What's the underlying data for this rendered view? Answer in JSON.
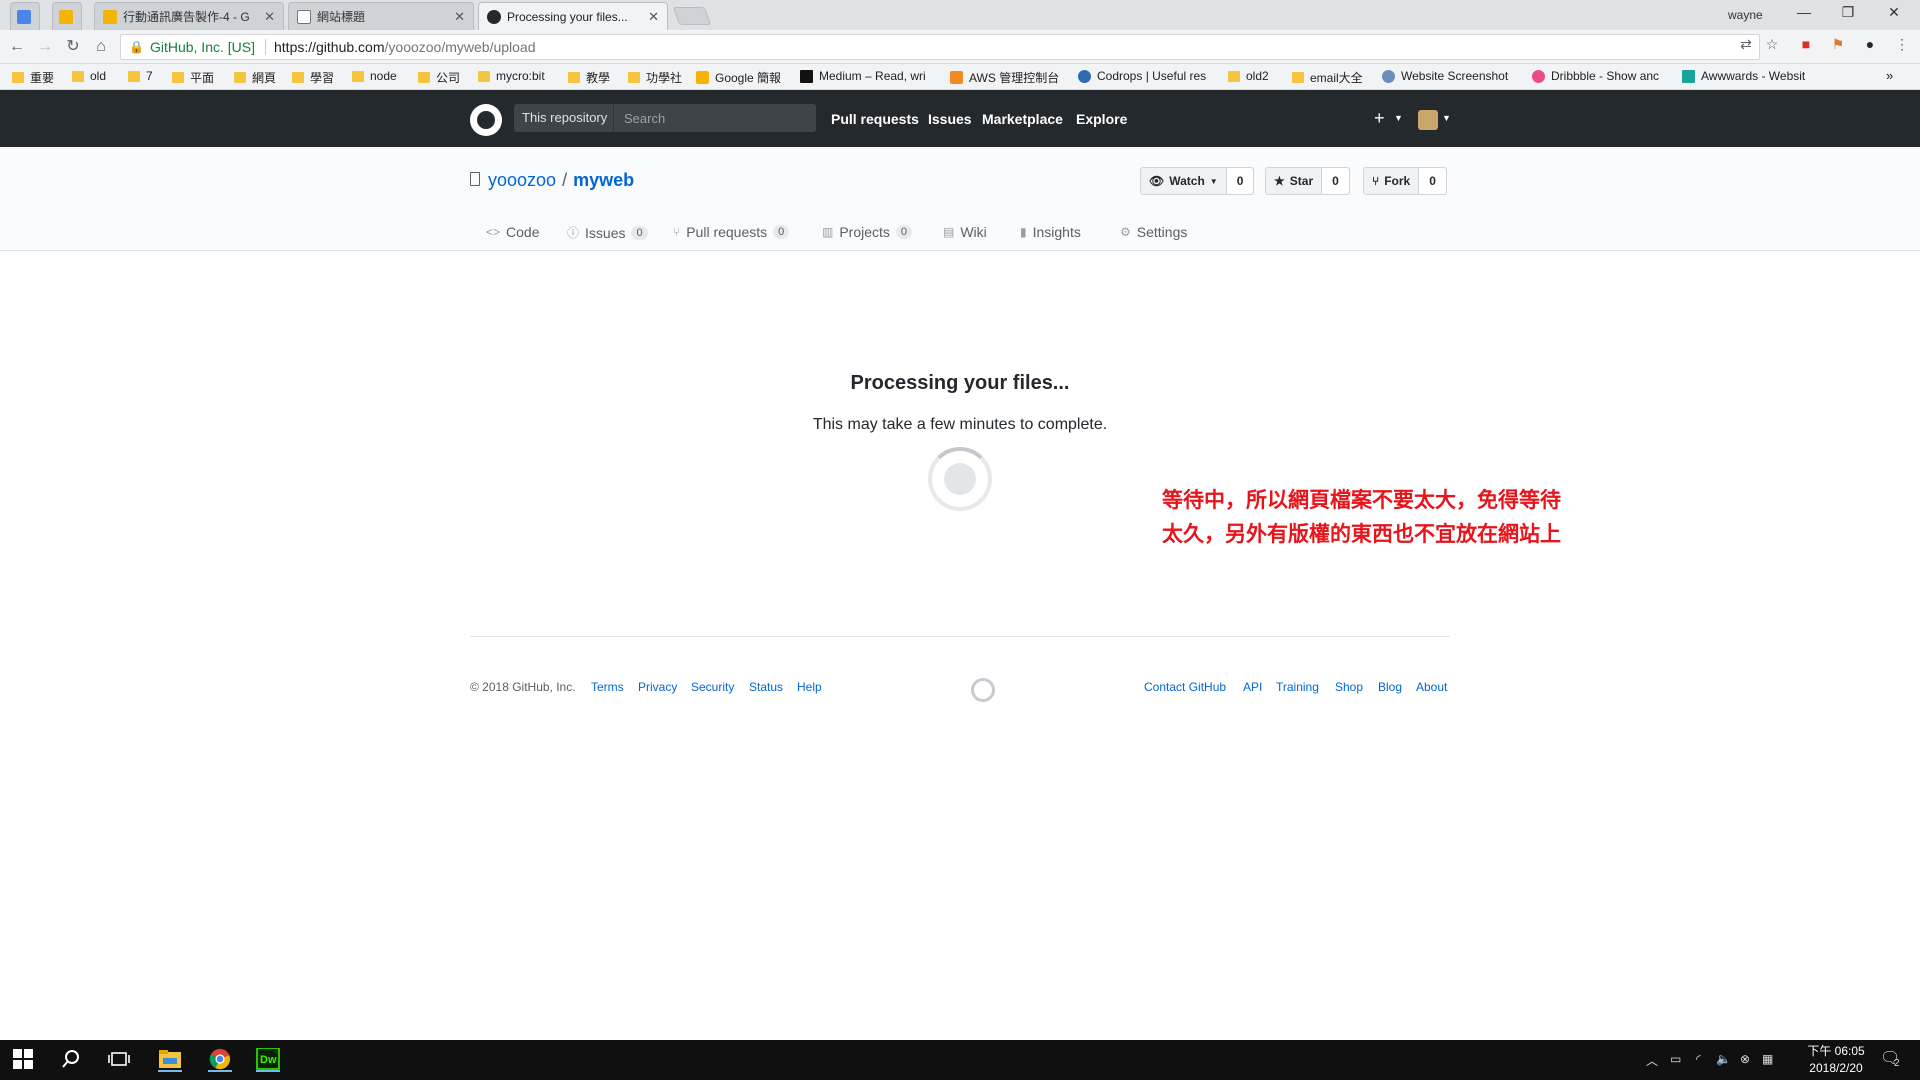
{
  "browser": {
    "tabs": [
      {
        "title": "",
        "active": false
      },
      {
        "title": "",
        "active": false
      },
      {
        "title": "行動通訊廣告製作-4 - G",
        "active": false
      },
      {
        "title": "網站標題",
        "active": false
      },
      {
        "title": "Processing your files...",
        "active": true
      }
    ],
    "profile_name": "wayne",
    "security_label": "GitHub, Inc. [US]",
    "url_host": "https://github.com",
    "url_path": "/yooozoo/myweb/upload",
    "bookmarks": [
      {
        "label": "重要",
        "type": "folder"
      },
      {
        "label": "old",
        "type": "folder"
      },
      {
        "label": "7",
        "type": "folder"
      },
      {
        "label": "平面",
        "type": "folder"
      },
      {
        "label": "網頁",
        "type": "folder"
      },
      {
        "label": "學習",
        "type": "folder"
      },
      {
        "label": "node",
        "type": "folder"
      },
      {
        "label": "公司",
        "type": "folder"
      },
      {
        "label": "mycro:bit",
        "type": "folder"
      },
      {
        "label": "教學",
        "type": "folder"
      },
      {
        "label": "功學社",
        "type": "folder"
      },
      {
        "label": "Google 簡報",
        "type": "site"
      },
      {
        "label": "Medium – Read, wri",
        "type": "site"
      },
      {
        "label": "AWS 管理控制台",
        "type": "site"
      },
      {
        "label": "Codrops | Useful res",
        "type": "site"
      },
      {
        "label": "old2",
        "type": "folder"
      },
      {
        "label": "email大全",
        "type": "folder"
      },
      {
        "label": "Website Screenshot",
        "type": "site"
      },
      {
        "label": "Dribbble - Show anc",
        "type": "site"
      },
      {
        "label": "Awwwards - Websit",
        "type": "site"
      }
    ]
  },
  "github": {
    "scope_label": "This repository",
    "search_placeholder": "Search",
    "nav": [
      "Pull requests",
      "Issues",
      "Marketplace",
      "Explore"
    ],
    "repo_owner": "yooozoo",
    "repo_name": "myweb",
    "watch": {
      "label": "Watch",
      "count": "0"
    },
    "star": {
      "label": "Star",
      "count": "0"
    },
    "fork": {
      "label": "Fork",
      "count": "0"
    },
    "reponav": [
      {
        "label": "Code",
        "count": null
      },
      {
        "label": "Issues",
        "count": "0"
      },
      {
        "label": "Pull requests",
        "count": "0"
      },
      {
        "label": "Projects",
        "count": "0"
      },
      {
        "label": "Wiki",
        "count": null
      },
      {
        "label": "Insights",
        "count": null
      },
      {
        "label": "Settings",
        "count": null
      }
    ],
    "processing_title": "Processing your files...",
    "processing_subtitle": "This may take a few minutes to complete.",
    "footer": {
      "copyright": "© 2018 GitHub, Inc.",
      "left_links": [
        "Terms",
        "Privacy",
        "Security",
        "Status",
        "Help"
      ],
      "right_links": [
        "Contact GitHub",
        "API",
        "Training",
        "Shop",
        "Blog",
        "About"
      ]
    }
  },
  "annotation": {
    "text": "等待中，所以網頁檔案不要太大，免得等待太久，另外有版權的東西也不宜放在網站上",
    "color": "#e8141b"
  },
  "taskbar": {
    "time": "下午 06:05",
    "date": "2018/2/20",
    "notification_count": "2"
  }
}
